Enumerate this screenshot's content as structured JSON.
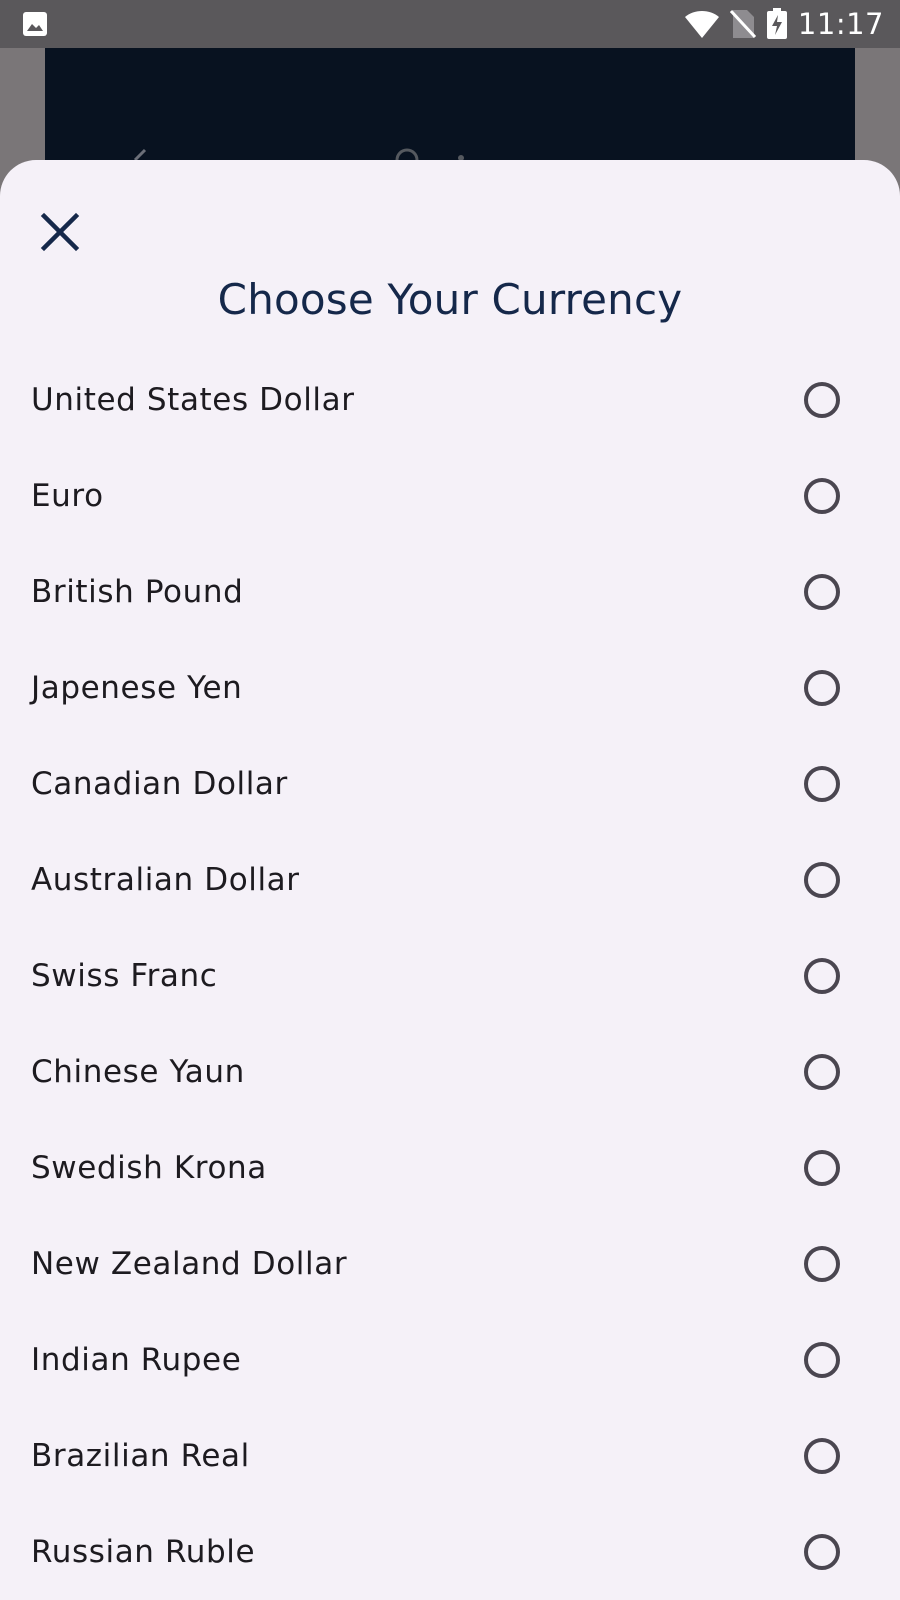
{
  "status_bar": {
    "time": "11:17",
    "icons": [
      "gallery-icon",
      "wifi-icon",
      "no-sim-icon",
      "battery-charging-icon"
    ]
  },
  "sheet": {
    "close_icon": "close-icon",
    "title": "Choose Your Currency",
    "currencies": [
      {
        "label": "United States Dollar",
        "selected": false
      },
      {
        "label": "Euro",
        "selected": false
      },
      {
        "label": "British Pound",
        "selected": false
      },
      {
        "label": "Japenese Yen",
        "selected": false
      },
      {
        "label": "Canadian Dollar",
        "selected": false
      },
      {
        "label": "Australian Dollar",
        "selected": false
      },
      {
        "label": "Swiss Franc",
        "selected": false
      },
      {
        "label": "Chinese Yaun",
        "selected": false
      },
      {
        "label": "Swedish Krona",
        "selected": false
      },
      {
        "label": "New Zealand Dollar",
        "selected": false
      },
      {
        "label": "Indian Rupee",
        "selected": false
      },
      {
        "label": "Brazilian Real",
        "selected": false
      },
      {
        "label": "Russian Ruble",
        "selected": false
      }
    ]
  },
  "colors": {
    "title": "#15284a",
    "sheet_background": "#f5f1f8",
    "backdrop_app": "#081220",
    "status_bar": "#5a585b",
    "radio_outline": "#4a4650"
  }
}
